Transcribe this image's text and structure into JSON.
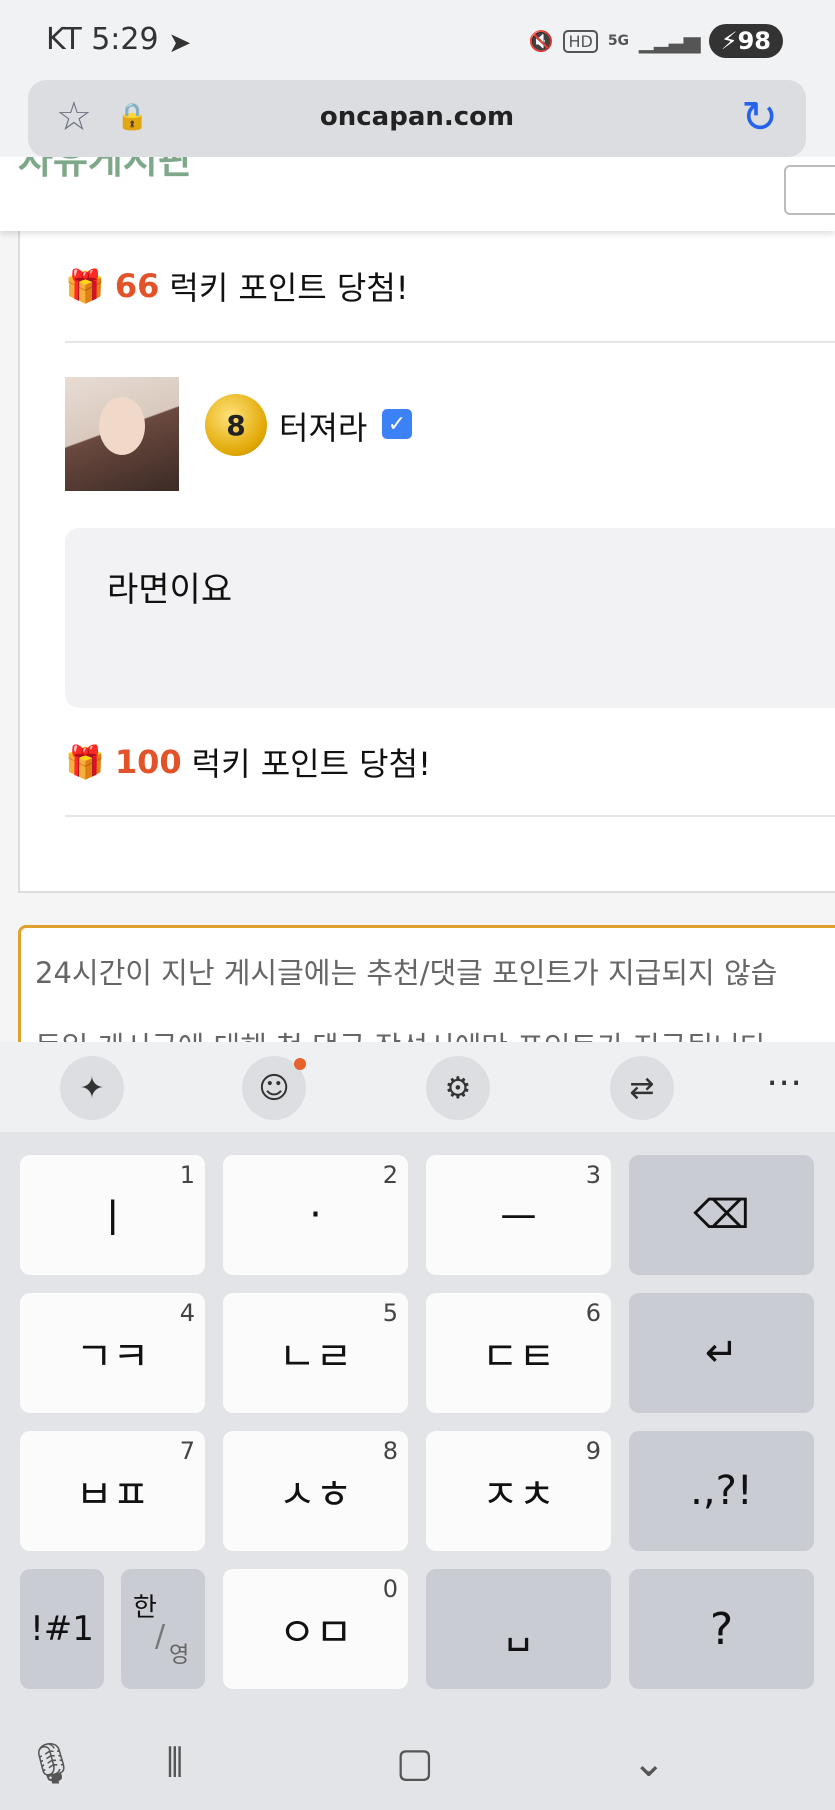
{
  "status_bar": {
    "carrier_time": "KT 5:29",
    "network": "5G",
    "hd": "HD",
    "battery": "98"
  },
  "browser": {
    "url": "oncapan.com"
  },
  "page": {
    "sticky_title": "자유게시판",
    "comment_1_lucky": {
      "points": "66",
      "text": "럭키 포인트 당첨!"
    },
    "comment_2": {
      "level": "8",
      "nickname": "터져라",
      "text": "라면이요"
    },
    "comment_2_lucky": {
      "points": "100",
      "text": "럭키 포인트 당첨!"
    },
    "notice": {
      "line1": "24시간이 지난 게시글에는 추천/댓글 포인트가 지급되지 않습",
      "line2": "동일 게시글에 대해 첫 댓글 작성시에만 포인트가 지급됩니다"
    }
  },
  "keyboard": {
    "rows": [
      [
        {
          "label": "ㅣ",
          "hint": "1"
        },
        {
          "label": "·",
          "hint": "2"
        },
        {
          "label": "ㅡ",
          "hint": "3"
        },
        {
          "label": "⌫",
          "hint": ""
        }
      ],
      [
        {
          "label": "ㄱㅋ",
          "hint": "4"
        },
        {
          "label": "ㄴㄹ",
          "hint": "5"
        },
        {
          "label": "ㄷㅌ",
          "hint": "6"
        },
        {
          "label": "↵",
          "hint": ""
        }
      ],
      [
        {
          "label": "ㅂㅍ",
          "hint": "7"
        },
        {
          "label": "ㅅㅎ",
          "hint": "8"
        },
        {
          "label": "ㅈㅊ",
          "hint": "9"
        },
        {
          "label": ".,?!",
          "hint": ""
        }
      ]
    ],
    "bottom": {
      "symbols": "!#1",
      "lang_top": "한",
      "lang_bottom": "영",
      "om": "ㅇㅁ",
      "om_hint": "0",
      "space": "␣",
      "question": "?"
    }
  }
}
